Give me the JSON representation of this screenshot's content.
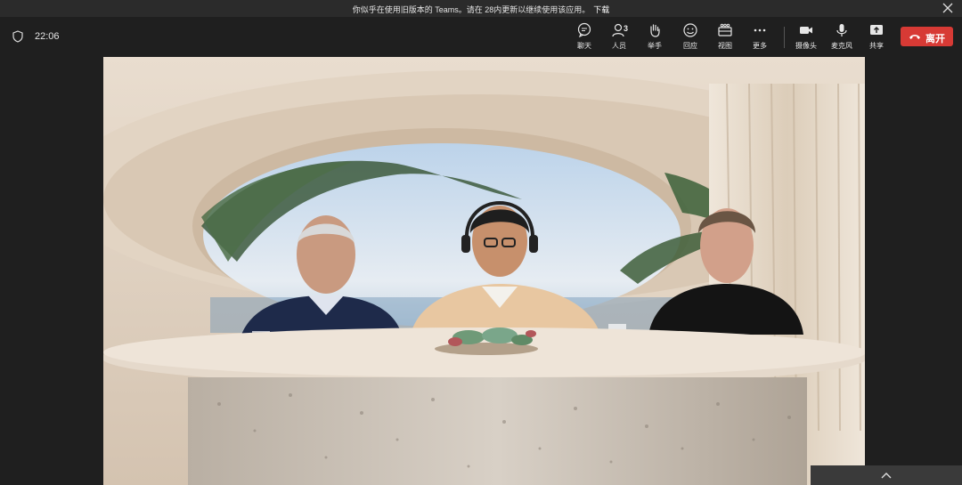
{
  "notice": {
    "text": "你似乎在使用旧版本的 Teams。请在 28内更新以继续使用该应用。",
    "link": "下载"
  },
  "meeting": {
    "time": "22:06"
  },
  "toolbar": {
    "chat": "聊天",
    "people": "人员",
    "people_count": "3",
    "raise_hand": "举手",
    "react": "回应",
    "view": "视图",
    "more": "更多",
    "camera": "摄像头",
    "mic": "麦克风",
    "share": "共享",
    "leave": "离开"
  },
  "colors": {
    "leave": "#d73a35",
    "toolbar_bg": "#1f1f1f"
  },
  "participants": [
    "participant-left",
    "participant-center",
    "participant-right"
  ]
}
